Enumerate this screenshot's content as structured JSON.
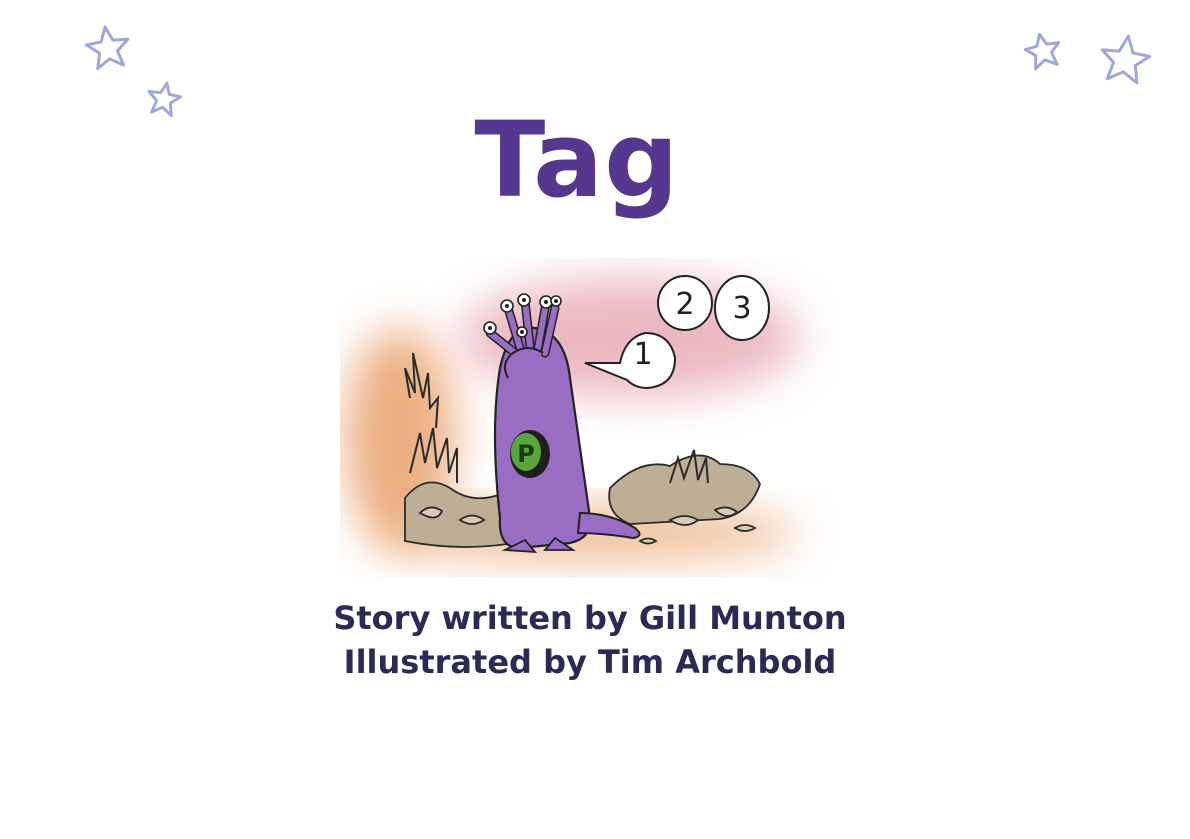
{
  "book": {
    "title": "Tag",
    "author_line": "Story written by Gill Munton",
    "illustrator_line": "Illustrated by Tim Archbold"
  },
  "illustration": {
    "subject": "purple alien covering eyes, counting",
    "speech_bubbles": [
      "1",
      "2",
      "3"
    ],
    "badge_letter": "P"
  },
  "decorations": {
    "icons": [
      "star-icon",
      "star-icon",
      "star-icon",
      "star-icon"
    ]
  },
  "colors": {
    "title": "#55378f",
    "credits": "#2b2a55",
    "star_outline": "#9ea8d8",
    "alien_body": "#9a6dc4",
    "badge": "#5aa63a",
    "glow_pink": "#e5a0ac",
    "glow_orange": "#e8a06a"
  }
}
